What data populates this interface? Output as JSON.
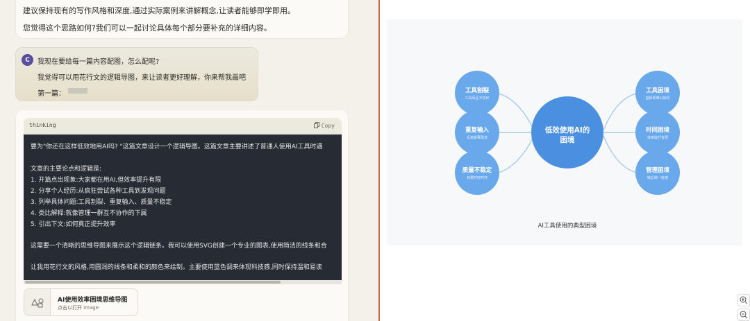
{
  "top_message": {
    "line1": "建议保持现有的写作风格和深度,通过实际案例来讲解概念,让读者能够即学即用。",
    "line2": "您觉得这个思路如何?我们可以一起讨论具体每个部分要补充的详细内容。"
  },
  "user_message": {
    "avatar_letter": "C",
    "line1": "我现在要给每一篇内容配图，怎么配呢?",
    "line2": "我觉得可以用花行文的逻辑导图，来让读者更好理解，你来帮我画吧",
    "line3": "第一篇："
  },
  "code_block": {
    "language": "thinking",
    "copy_label": "Copy",
    "lines": [
      "要为\"你还在这样低效地用AI吗? \"这篇文章设计一个逻辑导图。这篇文章主要讲述了普通人使用AI工具时遇",
      "文章的主要论点和逻辑是:",
      "1. 开篇点出现象:大家都在用AI,但效率提升有限",
      "2. 分享个人经历:从疯狂尝试各种工具到发现问题",
      "3. 列举具体问题:工具割裂、重复输入、质量不稳定",
      "4. 类比解释:就像管理一群互不协作的下属",
      "5. 引出下文:如何真正提升效率",
      "这需要一个清晰的思维导图来展示这个逻辑链条。我可以使用SVG创建一个专业的图表,使用简洁的线条和合",
      "让我用花行文的风格,用圆润的线条和柔和的颜色来绘制。主要使用蓝色调来体现科技感,同时保持温和易读"
    ]
  },
  "artifact_card": {
    "title": "AI使用效率困境思维导图",
    "subtitle": "点击以打开 image"
  },
  "diagram": {
    "center": {
      "line1": "低效使用AI的",
      "line2": "困境"
    },
    "left_nodes": [
      {
        "title": "工具割裂",
        "sub": "工具间互不协作"
      },
      {
        "title": "重复输入",
        "sub": "反复解释需求"
      },
      {
        "title": "质量不稳定",
        "sub": "效果时好时坏"
      }
    ],
    "right_nodes": [
      {
        "title": "工具困境",
        "sub": "指挥却难以协同"
      },
      {
        "title": "时间困境",
        "sub": "效率提升有限"
      },
      {
        "title": "管理困境",
        "sub": "缺乏统一标准"
      }
    ],
    "caption": "AI工具使用的典型困境",
    "colors": {
      "center": "#4a8fe0",
      "node": "#6aa8ec",
      "line": "#9cc3ec",
      "background": "#f7f8fa"
    }
  },
  "zoom_controls": {
    "zoom_in_icon": "zoom-in-icon",
    "zoom_out_icon": "zoom-out-icon"
  }
}
